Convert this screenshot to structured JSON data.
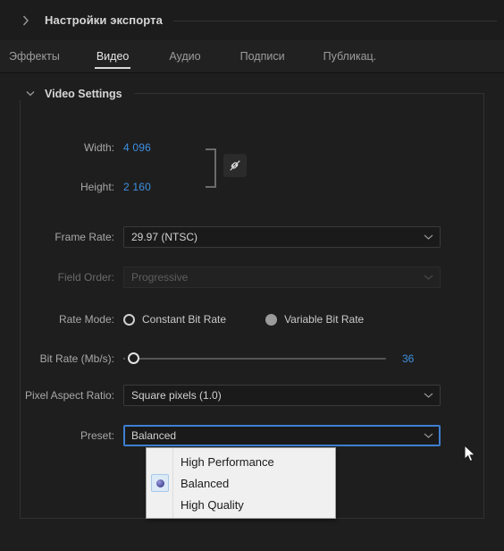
{
  "header": {
    "title": "Настройки экспорта",
    "chevron_icon": "chevron-right-icon"
  },
  "tabs": [
    {
      "label": "Эффекты",
      "active": false
    },
    {
      "label": "Видео",
      "active": true
    },
    {
      "label": "Аудио",
      "active": false
    },
    {
      "label": "Подписи",
      "active": false
    },
    {
      "label": "Публикац.",
      "active": false
    }
  ],
  "video_settings": {
    "legend": "Video Settings",
    "chevron_icon": "chevron-down-icon",
    "width": {
      "label": "Width:",
      "value": "4 096"
    },
    "height": {
      "label": "Height:",
      "value": "2 160"
    },
    "link_icon": "broken-link-icon",
    "frame_rate": {
      "label": "Frame Rate:",
      "value": "29.97 (NTSC)"
    },
    "field_order": {
      "label": "Field Order:",
      "value": "Progressive"
    },
    "rate_mode": {
      "label": "Rate Mode:",
      "options": [
        {
          "label": "Constant Bit Rate",
          "state": "unselected"
        },
        {
          "label": "Variable Bit Rate",
          "state": "selected"
        }
      ]
    },
    "bit_rate": {
      "label": "Bit Rate (Mb/s):",
      "value": "36",
      "slider_percent": 0
    },
    "pixel_aspect_ratio": {
      "label": "Pixel Aspect Ratio:",
      "value": "Square pixels (1.0)"
    },
    "preset": {
      "label": "Preset:",
      "value": "Balanced"
    }
  },
  "preset_dropdown": {
    "open": true,
    "items": [
      {
        "label": "High Performance",
        "selected": false
      },
      {
        "label": "Balanced",
        "selected": true
      },
      {
        "label": "High Quality",
        "selected": false
      }
    ]
  },
  "colors": {
    "background": "#1e1e1e",
    "accent_blue": "#3e8fe0",
    "focus_blue": "#3e7fd0",
    "menu_bg": "#f0f0f0",
    "radio_dot": "#5a5aa8"
  }
}
